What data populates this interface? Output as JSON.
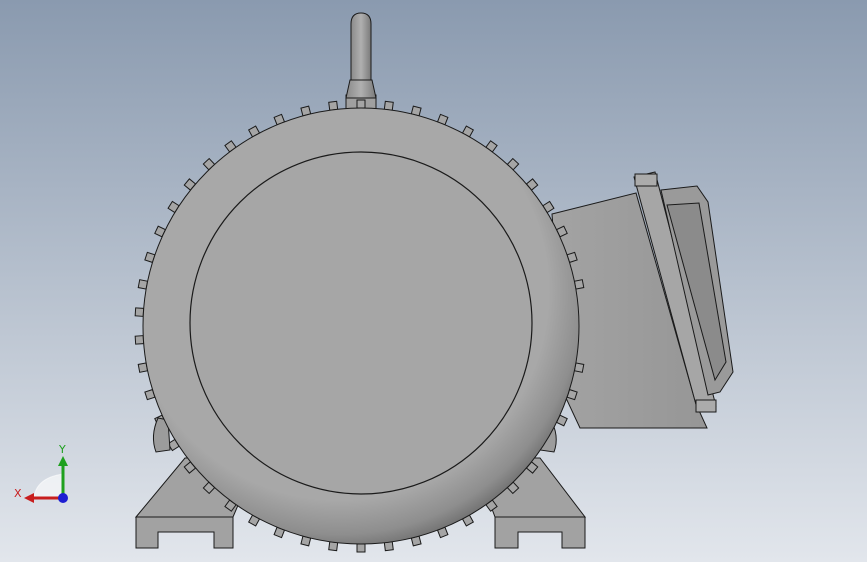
{
  "colors": {
    "background_top": "#8a9aaf",
    "background_bottom": "#e2e6ec",
    "body": "#a7a7a7",
    "body_dark": "#7d7d7d",
    "outline": "#1a1a1a",
    "x_axis": "#c81e1e",
    "y_axis": "#1ea01e",
    "z_axis": "#1e1ed2"
  },
  "triad": {
    "x_label": "X",
    "y_label": "Y"
  },
  "model": {
    "parts": [
      "motor-housing-icon",
      "end-cover-icon",
      "cooling-fins-icon",
      "lifting-eye-icon",
      "terminal-box-icon",
      "mounting-feet-icon"
    ]
  }
}
